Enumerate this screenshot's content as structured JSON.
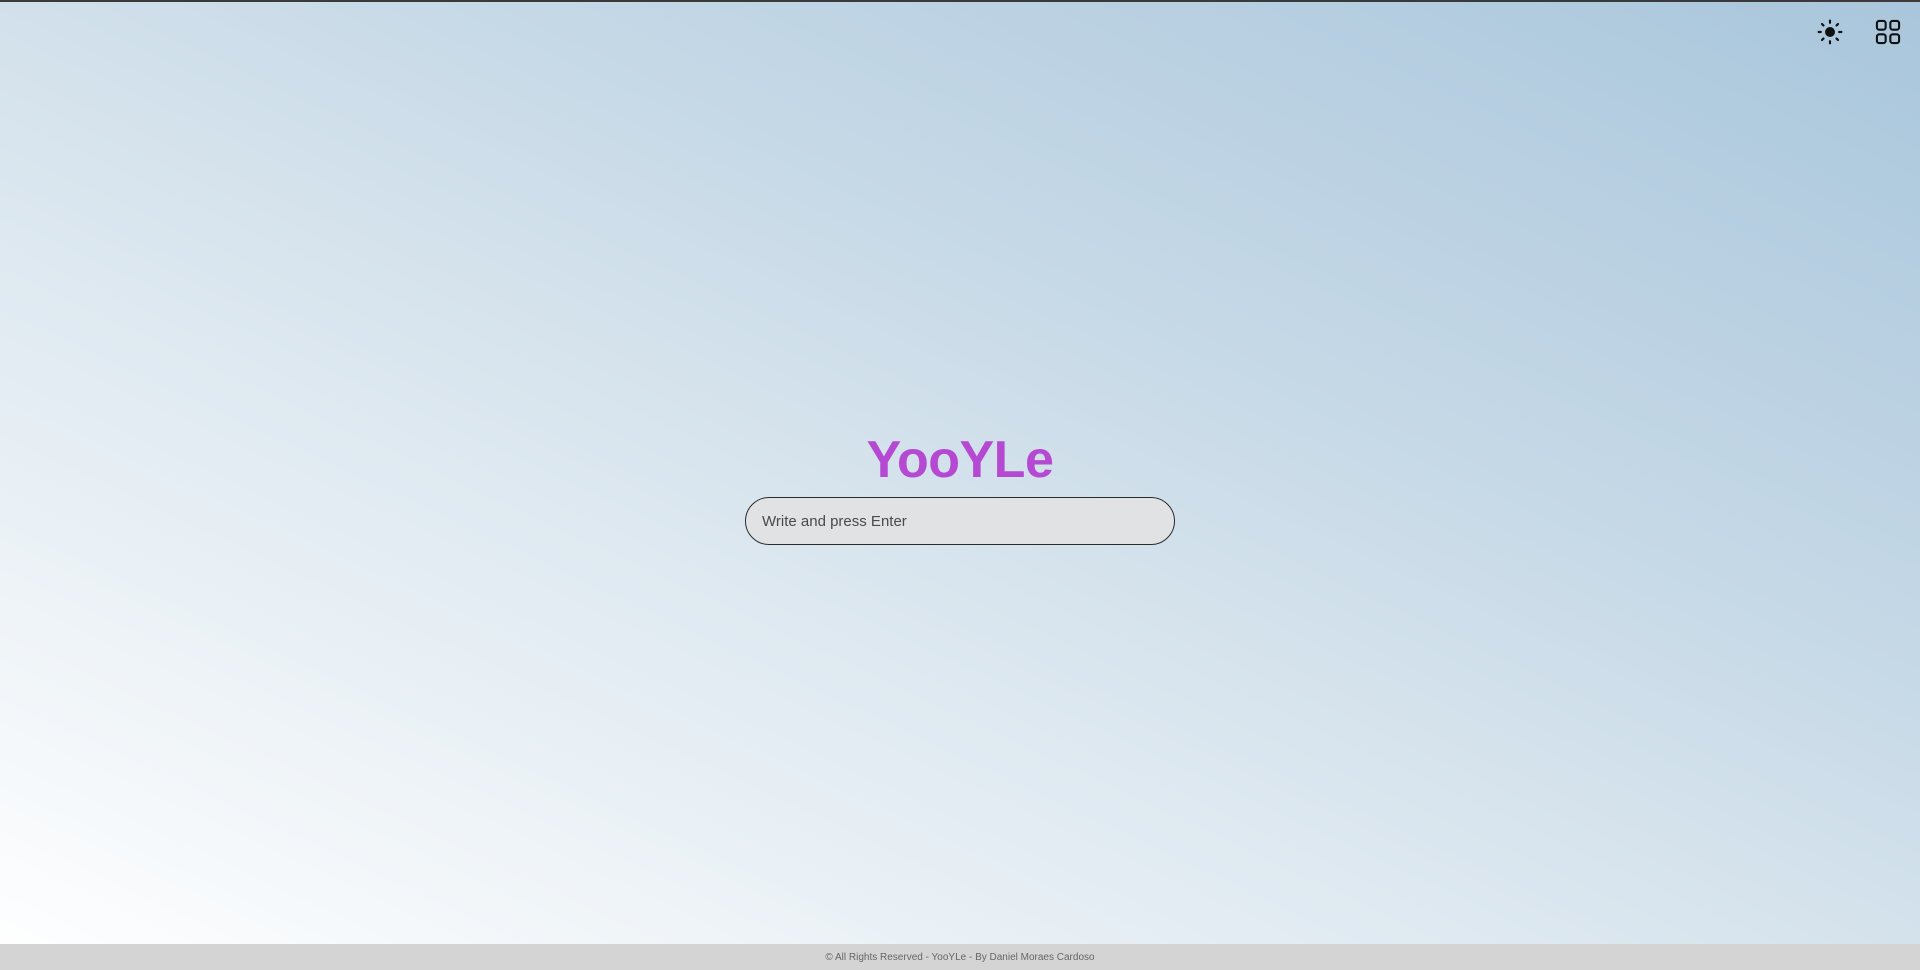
{
  "header": {
    "theme_toggle": {
      "icon": "sun-icon"
    },
    "apps_menu": {
      "icon": "grid-icon"
    }
  },
  "main": {
    "logo_text": "YooYLe",
    "logo_color": "#b549d2",
    "search": {
      "placeholder": "Write and press Enter",
      "value": ""
    }
  },
  "footer": {
    "text": "© All Rights Reserved - YooYLe - By Daniel Moraes Cardoso"
  }
}
